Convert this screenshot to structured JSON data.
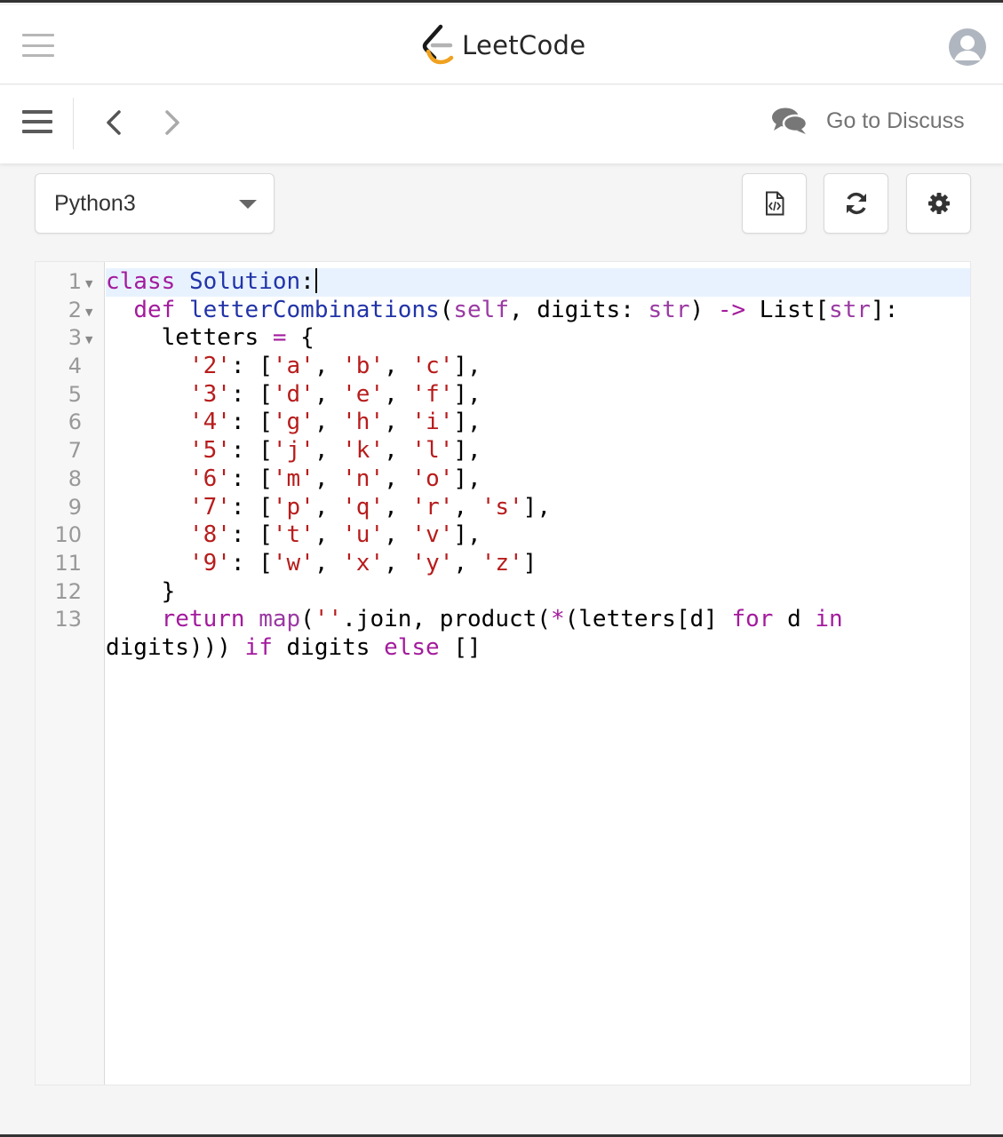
{
  "header": {
    "menu_icon": "hamburger-icon",
    "logo_text": "LeetCode",
    "avatar_icon": "user-avatar-icon"
  },
  "toolbar": {
    "menu_icon": "menu-icon",
    "prev_icon": "chevron-left-icon",
    "next_icon": "chevron-right-icon",
    "discuss_icon": "comments-icon",
    "discuss_label": "Go to Discuss"
  },
  "controls": {
    "language": "Python3",
    "buttons": [
      {
        "name": "code-file-icon"
      },
      {
        "name": "refresh-icon"
      },
      {
        "name": "gear-icon"
      }
    ]
  },
  "editor": {
    "line_numbers": [
      "1",
      "2",
      "3",
      "4",
      "5",
      "6",
      "7",
      "8",
      "9",
      "10",
      "11",
      "12",
      "13"
    ],
    "lines": [
      [
        [
          "kw",
          "class"
        ],
        [
          "t",
          " "
        ],
        [
          "def",
          "Solution"
        ],
        [
          "t",
          ":"
        ]
      ],
      [
        [
          "t",
          "  "
        ],
        [
          "kw",
          "def"
        ],
        [
          "t",
          " "
        ],
        [
          "def",
          "letterCombinations"
        ],
        [
          "t",
          "("
        ],
        [
          "bi",
          "self"
        ],
        [
          "t",
          ", digits: "
        ],
        [
          "bi",
          "str"
        ],
        [
          "t",
          ") "
        ],
        [
          "op",
          "->"
        ],
        [
          "t",
          " List["
        ],
        [
          "bi",
          "str"
        ],
        [
          "t",
          "]:"
        ]
      ],
      [
        [
          "t",
          "    letters "
        ],
        [
          "op",
          "="
        ],
        [
          "t",
          " {"
        ]
      ],
      [
        [
          "t",
          "      "
        ],
        [
          "str",
          "'2'"
        ],
        [
          "t",
          ": ["
        ],
        [
          "str",
          "'a'"
        ],
        [
          "t",
          ", "
        ],
        [
          "str",
          "'b'"
        ],
        [
          "t",
          ", "
        ],
        [
          "str",
          "'c'"
        ],
        [
          "t",
          "],"
        ]
      ],
      [
        [
          "t",
          "      "
        ],
        [
          "str",
          "'3'"
        ],
        [
          "t",
          ": ["
        ],
        [
          "str",
          "'d'"
        ],
        [
          "t",
          ", "
        ],
        [
          "str",
          "'e'"
        ],
        [
          "t",
          ", "
        ],
        [
          "str",
          "'f'"
        ],
        [
          "t",
          "],"
        ]
      ],
      [
        [
          "t",
          "      "
        ],
        [
          "str",
          "'4'"
        ],
        [
          "t",
          ": ["
        ],
        [
          "str",
          "'g'"
        ],
        [
          "t",
          ", "
        ],
        [
          "str",
          "'h'"
        ],
        [
          "t",
          ", "
        ],
        [
          "str",
          "'i'"
        ],
        [
          "t",
          "],"
        ]
      ],
      [
        [
          "t",
          "      "
        ],
        [
          "str",
          "'5'"
        ],
        [
          "t",
          ": ["
        ],
        [
          "str",
          "'j'"
        ],
        [
          "t",
          ", "
        ],
        [
          "str",
          "'k'"
        ],
        [
          "t",
          ", "
        ],
        [
          "str",
          "'l'"
        ],
        [
          "t",
          "],"
        ]
      ],
      [
        [
          "t",
          "      "
        ],
        [
          "str",
          "'6'"
        ],
        [
          "t",
          ": ["
        ],
        [
          "str",
          "'m'"
        ],
        [
          "t",
          ", "
        ],
        [
          "str",
          "'n'"
        ],
        [
          "t",
          ", "
        ],
        [
          "str",
          "'o'"
        ],
        [
          "t",
          "],"
        ]
      ],
      [
        [
          "t",
          "      "
        ],
        [
          "str",
          "'7'"
        ],
        [
          "t",
          ": ["
        ],
        [
          "str",
          "'p'"
        ],
        [
          "t",
          ", "
        ],
        [
          "str",
          "'q'"
        ],
        [
          "t",
          ", "
        ],
        [
          "str",
          "'r'"
        ],
        [
          "t",
          ", "
        ],
        [
          "str",
          "'s'"
        ],
        [
          "t",
          "],"
        ]
      ],
      [
        [
          "t",
          "      "
        ],
        [
          "str",
          "'8'"
        ],
        [
          "t",
          ": ["
        ],
        [
          "str",
          "'t'"
        ],
        [
          "t",
          ", "
        ],
        [
          "str",
          "'u'"
        ],
        [
          "t",
          ", "
        ],
        [
          "str",
          "'v'"
        ],
        [
          "t",
          "],"
        ]
      ],
      [
        [
          "t",
          "      "
        ],
        [
          "str",
          "'9'"
        ],
        [
          "t",
          ": ["
        ],
        [
          "str",
          "'w'"
        ],
        [
          "t",
          ", "
        ],
        [
          "str",
          "'x'"
        ],
        [
          "t",
          ", "
        ],
        [
          "str",
          "'y'"
        ],
        [
          "t",
          ", "
        ],
        [
          "str",
          "'z'"
        ],
        [
          "t",
          "]"
        ]
      ],
      [
        [
          "t",
          "    }"
        ]
      ],
      [
        [
          "t",
          "    "
        ],
        [
          "kw",
          "return"
        ],
        [
          "t",
          " "
        ],
        [
          "bi",
          "map"
        ],
        [
          "t",
          "("
        ],
        [
          "str",
          "''"
        ],
        [
          "t",
          ".join, product("
        ],
        [
          "op",
          "*"
        ],
        [
          "t",
          "(letters[d] "
        ],
        [
          "kw",
          "for"
        ],
        [
          "t",
          " d "
        ],
        [
          "kw",
          "in"
        ]
      ],
      [
        [
          "t",
          "digits))) "
        ],
        [
          "kw",
          "if"
        ],
        [
          "t",
          " digits "
        ],
        [
          "kw",
          "else"
        ],
        [
          "t",
          " []"
        ]
      ]
    ],
    "colors": {
      "keyword": "#a31b9d",
      "definition": "#2234a8",
      "builtin": "#9a3aa3",
      "string": "#b81c1c",
      "active_line": "#e8f2ff"
    }
  }
}
